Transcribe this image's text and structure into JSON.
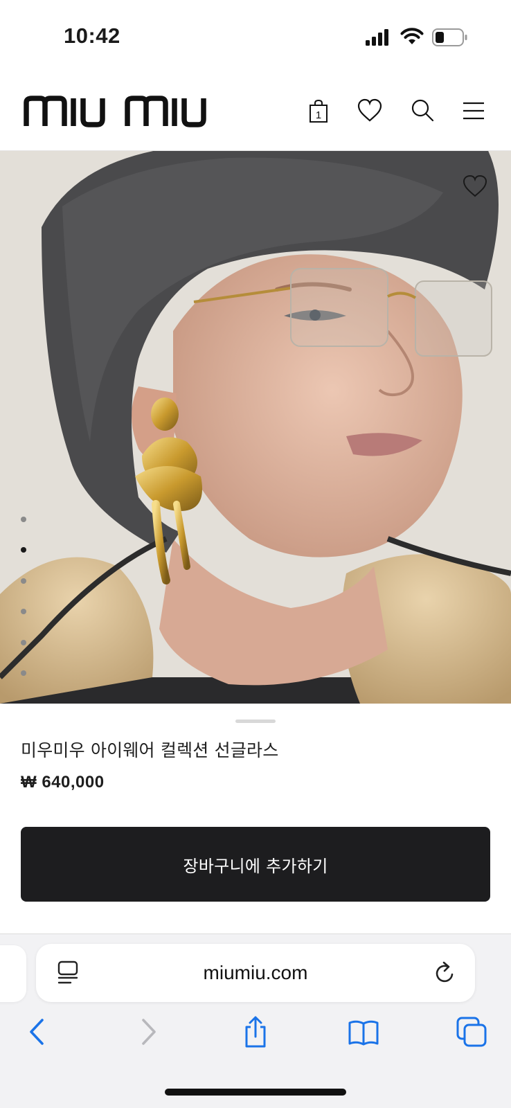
{
  "status_bar": {
    "time": "10:42"
  },
  "header": {
    "logo_text": "miu miu",
    "bag_count": "1",
    "icons": [
      "shopping-bag-icon",
      "heart-icon",
      "search-icon",
      "menu-icon"
    ]
  },
  "gallery": {
    "dots_count": 6,
    "active_dot": 2
  },
  "product": {
    "name": "미우미우 아이웨어 컬렉션 선글라스",
    "price": "₩ 640,000",
    "add_to_cart_label": "장바구니에 추가하기"
  },
  "browser": {
    "url": "miumiu.com",
    "toolbar_icons": [
      "back-icon",
      "forward-icon",
      "share-icon",
      "bookmarks-icon",
      "tabs-icon"
    ]
  },
  "colors": {
    "accent": "#1d1d1f",
    "safari_blue": "#1a73e8",
    "toolbar_bg": "#f2f2f4"
  }
}
